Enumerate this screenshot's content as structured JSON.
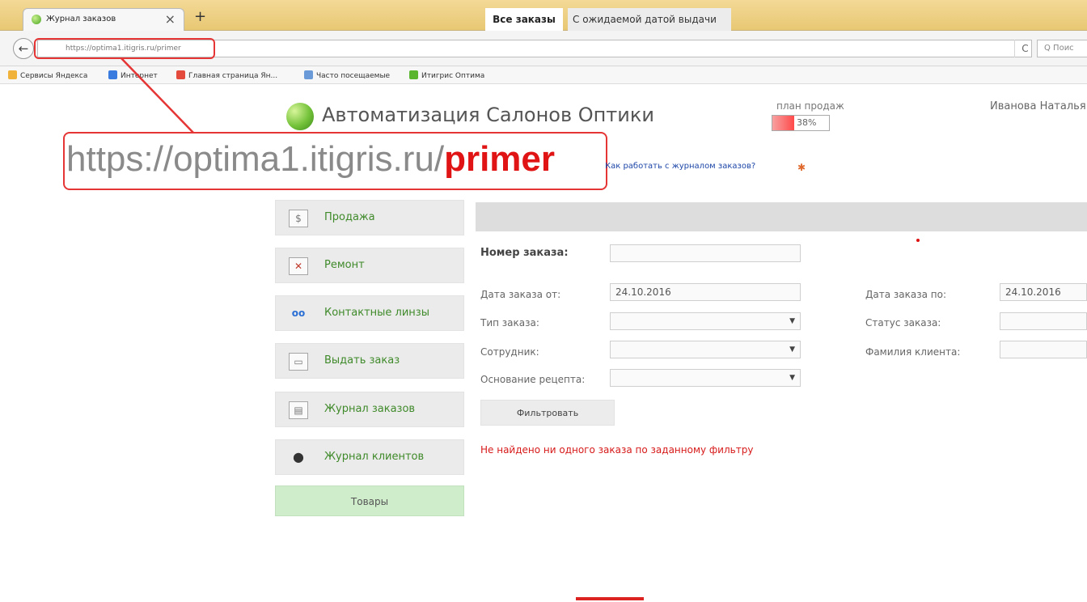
{
  "browser": {
    "tab_title": "Журнал заказов",
    "tab_close": "×",
    "new_tab": "+",
    "back": "←",
    "url": "https://optima1.itigris.ru/primer",
    "reload": "C",
    "search_placeholder": "Q Поис",
    "bookmarks": [
      {
        "label": "Сервисы Яндекса",
        "color": "#f0b23a"
      },
      {
        "label": "Интернет",
        "color": "#3a7be0"
      },
      {
        "label": "Главная страница Ян...",
        "color": "#e54b3c"
      },
      {
        "label": "Часто посещаемые",
        "color": "#6a9bd8"
      },
      {
        "label": "Итигрис Оптима",
        "color": "#5bb52e"
      }
    ]
  },
  "header": {
    "app_title": "Автоматизация Салонов Оптики",
    "sales_plan_label": "план продаж",
    "sales_plan_value": "38%",
    "sales_plan_fraction": 0.38,
    "user_name": "Иванова Наталья"
  },
  "callout": {
    "url_prefix": "https://optima1.itigris.ru/",
    "url_suffix": "primer"
  },
  "help": {
    "link": "Как работать с журналом заказов?",
    "icon": "✱"
  },
  "sidebar": {
    "items": [
      {
        "label": "Продажа",
        "icon": "dollar-icon",
        "glyph": "$"
      },
      {
        "label": "Ремонт",
        "icon": "tools-icon",
        "glyph": "✕"
      },
      {
        "label": "Контактные линзы",
        "icon": "lens-icon",
        "glyph": "oo"
      },
      {
        "label": "Выдать заказ",
        "icon": "issue-order-icon",
        "glyph": "▭"
      },
      {
        "label": "Журнал заказов",
        "icon": "order-journal-icon",
        "glyph": "▤"
      },
      {
        "label": "Журнал клиентов",
        "icon": "client-journal-icon",
        "glyph": "●"
      }
    ],
    "goods": "Товары"
  },
  "main": {
    "tabs": [
      {
        "label": "Все заказы",
        "active": true
      },
      {
        "label": "С ожидаемой датой выдачи",
        "active": false
      }
    ],
    "filters": {
      "order_number_label": "Номер заказа:",
      "order_number_value": "",
      "date_from_label": "Дата заказа от:",
      "date_from_value": "24.10.2016",
      "date_to_label": "Дата заказа по:",
      "date_to_value": "24.10.2016",
      "order_type_label": "Тип заказа:",
      "order_type_value": "",
      "order_status_label": "Статус заказа:",
      "order_status_value": "",
      "employee_label": "Сотрудник:",
      "employee_value": "",
      "client_surname_label": "Фамилия клиента:",
      "client_surname_value": "",
      "prescription_label": "Основание рецепта:",
      "prescription_value": "",
      "dropdown_arrow": "▼"
    },
    "filter_button": "Фильтровать",
    "no_results": "Не найдено ни одного заказа по заданному фильтру"
  }
}
